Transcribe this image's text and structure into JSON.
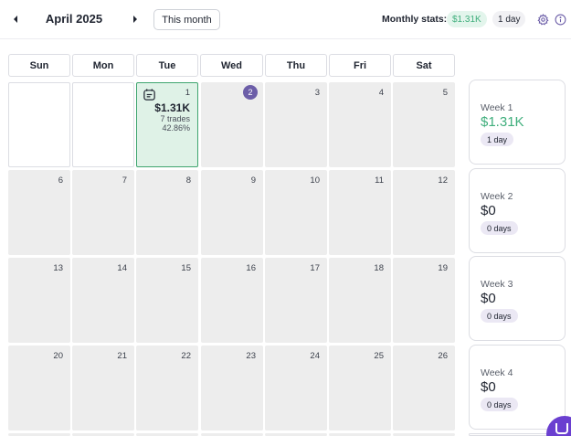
{
  "header": {
    "month_label": "April 2025",
    "this_month_label": "This month",
    "stats_label": "Monthly stats:",
    "stats_value": "$1.31K",
    "stats_days": "1 day",
    "icons": [
      "chevron-left-icon",
      "chevron-right-icon",
      "gear-icon",
      "info-icon"
    ]
  },
  "weekdays": [
    "Sun",
    "Mon",
    "Tue",
    "Wed",
    "Thu",
    "Fri",
    "Sat"
  ],
  "days": {
    "tue_1": {
      "num": "1",
      "pnl": "$1.31K",
      "trades": "7 trades",
      "rate": "42.86%"
    },
    "wed_2": {
      "num": "2"
    },
    "thu_3": {
      "num": "3"
    },
    "fri_4": {
      "num": "4"
    },
    "sat_5": {
      "num": "5"
    },
    "d6": "6",
    "d7": "7",
    "d8": "8",
    "d9": "9",
    "d10": "10",
    "d11": "11",
    "d12": "12",
    "d13": "13",
    "d14": "14",
    "d15": "15",
    "d16": "16",
    "d17": "17",
    "d18": "18",
    "d19": "19",
    "d20": "20",
    "d21": "21",
    "d22": "22",
    "d23": "23",
    "d24": "24",
    "d25": "25",
    "d26": "26"
  },
  "weeks": [
    {
      "title": "Week 1",
      "pnl": "$1.31K",
      "days": "1 day"
    },
    {
      "title": "Week 2",
      "pnl": "$0",
      "days": "0 days"
    },
    {
      "title": "Week 3",
      "pnl": "$0",
      "days": "0 days"
    },
    {
      "title": "Week 4",
      "pnl": "$0",
      "days": "0 days"
    }
  ],
  "colors": {
    "accent": "#6c5ea8",
    "positive": "#3fae7c",
    "win_cell": "#dff2e7",
    "cell_bg": "#ededed",
    "chat": "#6a3fd0"
  }
}
